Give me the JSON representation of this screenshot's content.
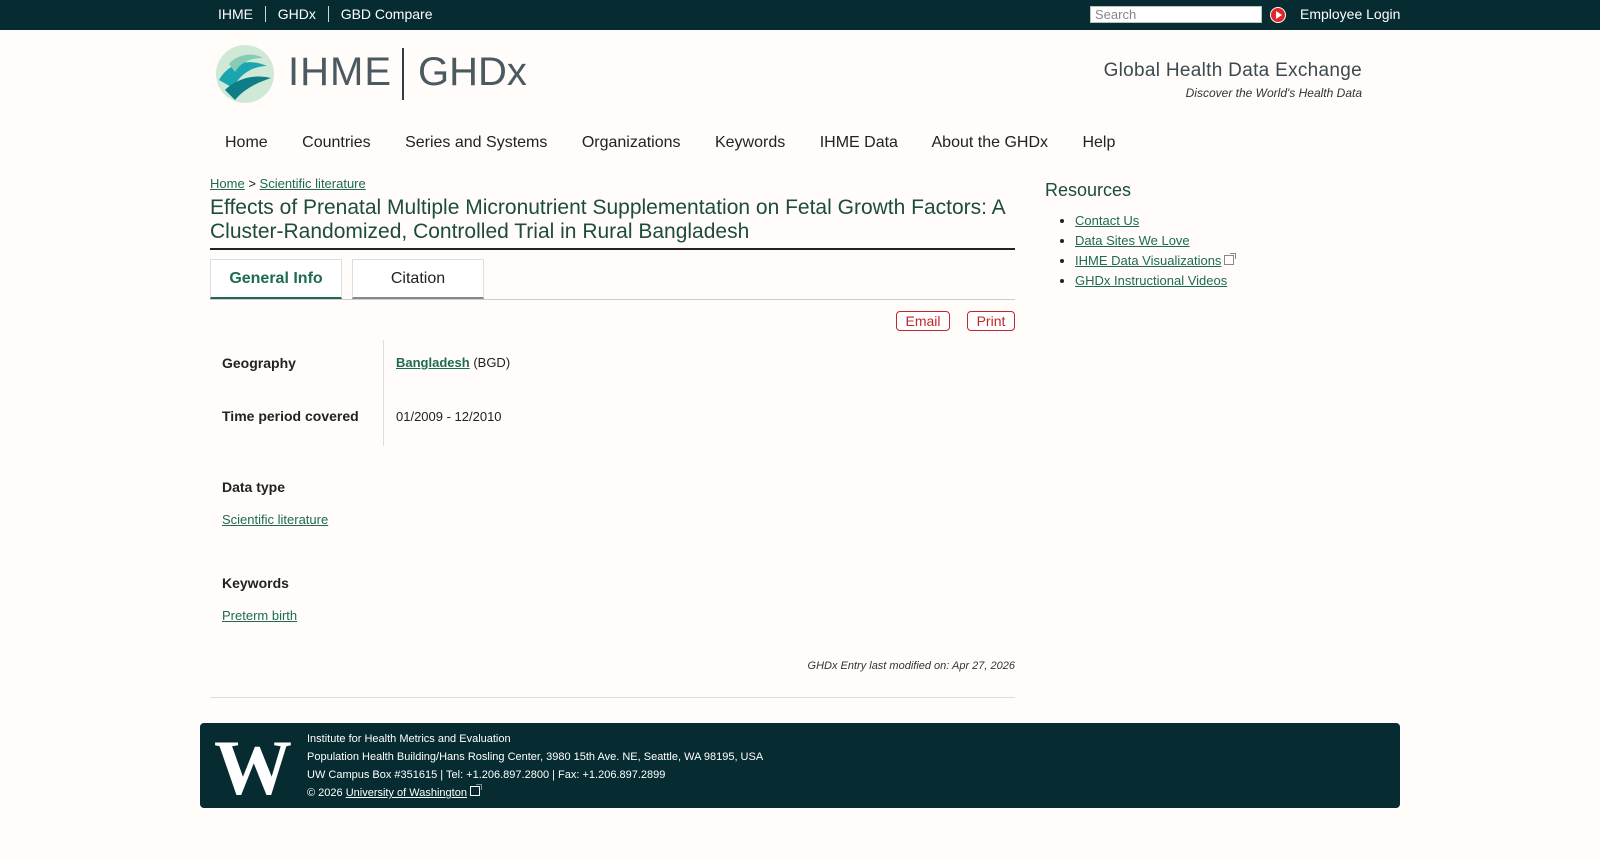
{
  "topbar": {
    "links": [
      "IHME",
      "GHDx",
      "GBD Compare"
    ],
    "search_placeholder": "Search",
    "login_label": "Employee Login"
  },
  "header": {
    "brand_left": "IHME",
    "brand_right": "GHDx",
    "tagline": "Global Health Data Exchange",
    "subtagline": "Discover the World's Health Data"
  },
  "nav": {
    "items": [
      "Home",
      "Countries",
      "Series and Systems",
      "Organizations",
      "Keywords",
      "IHME Data",
      "About the GHDx",
      "Help"
    ]
  },
  "breadcrumb": {
    "home": "Home",
    "sep": ">",
    "current": "Scientific literature"
  },
  "page": {
    "title": "Effects of Prenatal Multiple Micronutrient Supplementation on Fetal Growth Factors: A Cluster-Randomized, Controlled Trial in Rural Bangladesh",
    "tabs": [
      "General Info",
      "Citation"
    ],
    "actions": {
      "email": "Email",
      "print": "Print"
    },
    "fields": {
      "geography_label": "Geography",
      "geography_value": "Bangladesh",
      "geography_code": "(BGD)",
      "time_label": "Time period covered",
      "time_value": "01/2009 - 12/2010",
      "datatype_label": "Data type",
      "datatype_value": "Scientific literature",
      "keywords_label": "Keywords",
      "keywords_value": "Preterm birth"
    },
    "modified": "GHDx Entry last modified on: Apr 27, 2026"
  },
  "sidebar": {
    "title": "Resources",
    "items": [
      "Contact Us",
      "Data Sites We Love",
      "IHME Data Visualizations",
      "GHDx Instructional Videos"
    ]
  },
  "footer": {
    "logo_letter": "W",
    "line1": "Institute for Health Metrics and Evaluation",
    "line2": "Population Health Building/Hans Rosling Center, 3980 15th Ave. NE, Seattle, WA 98195, USA",
    "line3": "UW Campus Box #351615 | Tel: +1.206.897.2800 | Fax: +1.206.897.2899",
    "line4_prefix": "© 2026",
    "line4_link": "University of Washington"
  },
  "colors": {
    "topbar": "#062b30",
    "link": "#1d6b52",
    "accent_red": "#c0272d",
    "background": "#fffcf9"
  }
}
